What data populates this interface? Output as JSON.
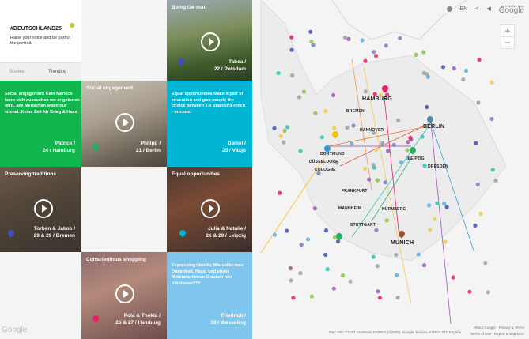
{
  "header": {
    "hashtag": "#DEUTSCHLAND25",
    "tagline": "Raise your voice and be part of the portrait."
  },
  "tabs": [
    {
      "label": "Stories"
    },
    {
      "label": "Trending"
    }
  ],
  "toolbar": {
    "info_icon": "info-icon",
    "language": "EN",
    "share_icon": "share-icon",
    "sound_icon": "speaker-icon",
    "google_small": "an initiative from",
    "google": "Google"
  },
  "zoom": {
    "in": "+",
    "out": "−"
  },
  "tiles": [
    {
      "title": "Being German",
      "name": "Tabea /",
      "meta": "22 / Potsdam"
    },
    {
      "title": "",
      "body": "Social engagement Kein Mensch kann sich aussuchen wo er geboren wird, alle Menschen leben nur einmal. Keine Zeit für Krieg & Hass.",
      "name": "Patrick /",
      "meta": "24 / Hamburg"
    },
    {
      "title": "Social engagement",
      "name": "Philipp /",
      "meta": "21 / Berlin"
    },
    {
      "title": "",
      "body": "Equal opportunities Make it part of education and give people the choice between e.g Spanish/French - or code.",
      "name": "Daniel /",
      "meta": "25 / Växjö"
    },
    {
      "title": "Preserving traditions",
      "name": "Torben & Jakob /",
      "meta": "29 & 29 / Bremen"
    },
    {
      "title": "Equal opportunities",
      "name": "Julia & Natalie /",
      "meta": "26 & 29 / Leipzig"
    },
    {
      "title": "Conscientious shopping",
      "name": "Pola & Thekla /",
      "meta": "25 & 27 / Hamburg"
    },
    {
      "title": "",
      "body": "Expressing identity Wie sollte man Dummheit, Hass, und einen Mittelalterlichen Glauben hier Etablieren???",
      "name": "Friedrich /",
      "meta": "58 / Wesseling"
    }
  ],
  "cities": {
    "hamburg": "HAMBURG",
    "bremen": "BREMEN",
    "hannover": "HANNOVER",
    "berlin": "BERLIN",
    "dortmund": "DORTMUND",
    "dusseldorf": "DÜSSELDORF",
    "cologne": "COLOGNE",
    "leipzig": "LEIPZIG",
    "dresden": "DRESDEN",
    "frankfurt": "FRANKFURT",
    "mannheim": "MANNHEIM",
    "nurnberg": "NÜRNBERG",
    "stuttgart": "STUTTGART",
    "munich": "MUNICH"
  },
  "footer": {
    "google_logo": "Google",
    "attribution": "Map data ©2014 GeoBasis-DE/BKG (©2009), Google, basado en BCN IGN España",
    "terms": "Terms of Use",
    "report": "Report a map error",
    "about": "About Google",
    "privacy": "Privacy & Terms"
  }
}
